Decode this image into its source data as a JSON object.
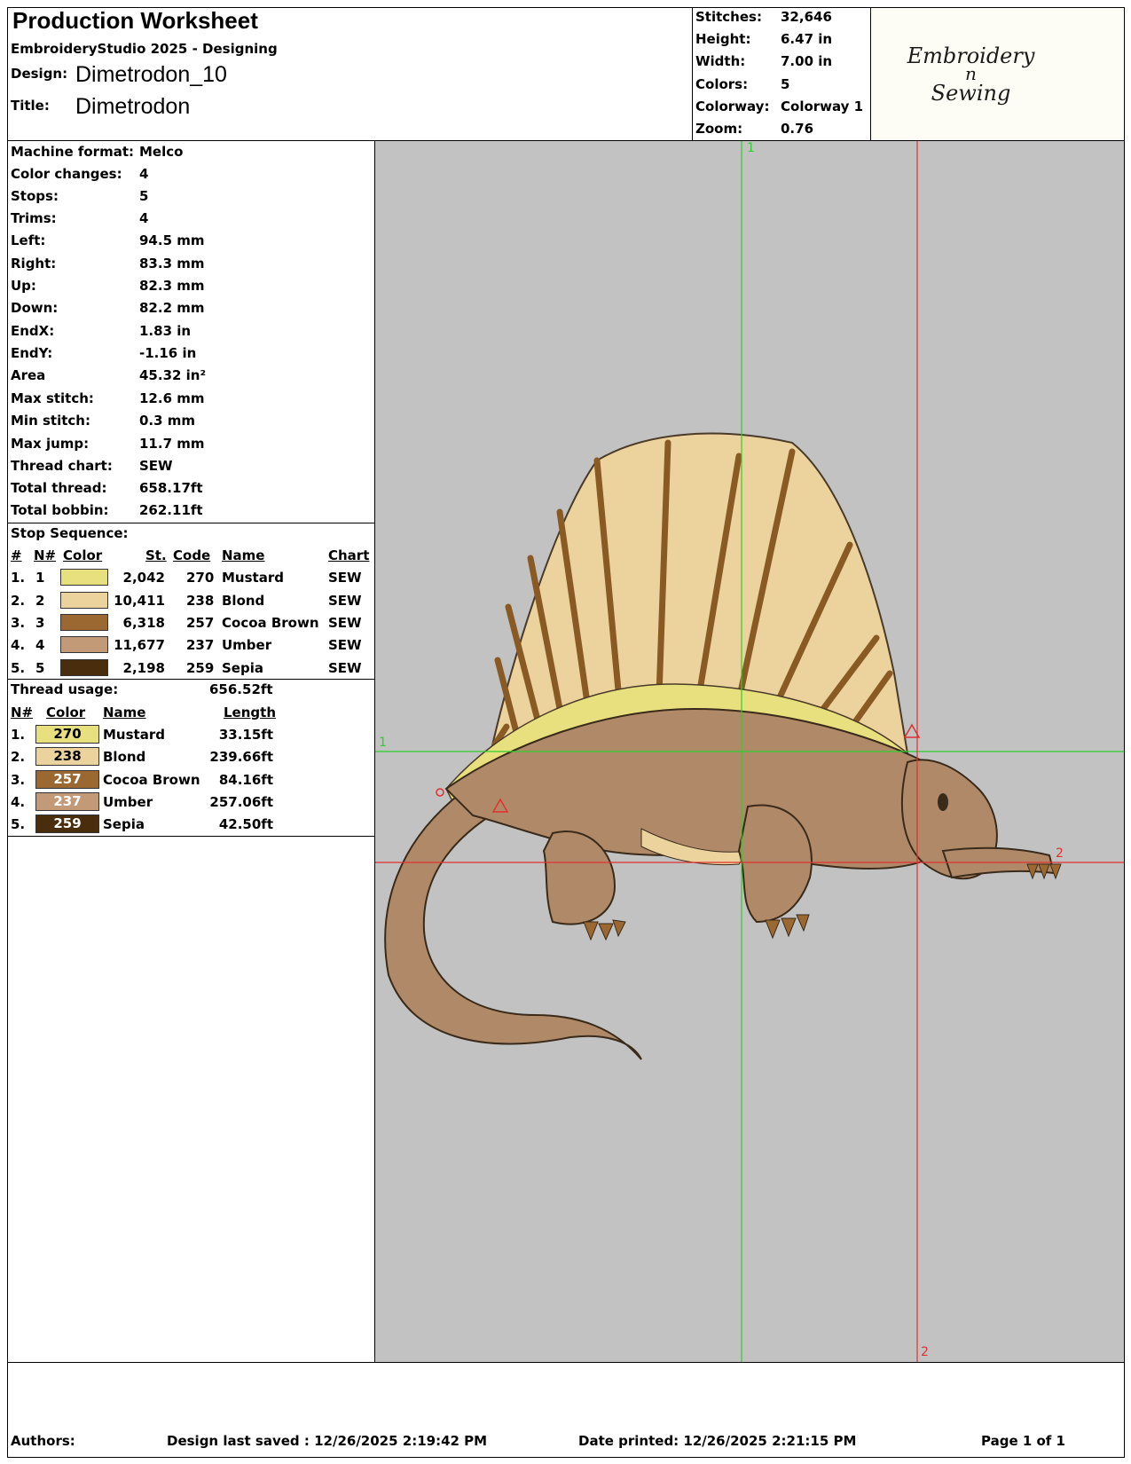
{
  "header": {
    "title": "Production Worksheet",
    "software": "EmbroideryStudio 2025 - Designing",
    "design_label": "Design:",
    "design_value": "Dimetrodon_10",
    "title_label": "Title:",
    "title_value": "Dimetrodon"
  },
  "summary": [
    {
      "label": "Stitches:",
      "value": "32,646"
    },
    {
      "label": "Height:",
      "value": "6.47 in"
    },
    {
      "label": "Width:",
      "value": "7.00 in"
    },
    {
      "label": "Colors:",
      "value": "5"
    },
    {
      "label": "Colorway:",
      "value": "Colorway 1"
    },
    {
      "label": "Zoom:",
      "value": "0.76"
    }
  ],
  "logo": {
    "line1": "Embroidery",
    "line2": "n",
    "line3": "Sewing"
  },
  "details": [
    {
      "label": "Machine format:",
      "value": "Melco"
    },
    {
      "label": "Color changes:",
      "value": "4"
    },
    {
      "label": "Stops:",
      "value": "5"
    },
    {
      "label": "Trims:",
      "value": "4"
    },
    {
      "label": "Left:",
      "value": "94.5 mm"
    },
    {
      "label": "Right:",
      "value": "83.3 mm"
    },
    {
      "label": "Up:",
      "value": "82.3 mm"
    },
    {
      "label": "Down:",
      "value": "82.2 mm"
    },
    {
      "label": "EndX:",
      "value": "1.83 in"
    },
    {
      "label": "EndY:",
      "value": "-1.16 in"
    },
    {
      "label": "Area",
      "value": " 45.32 in²"
    },
    {
      "label": "Max stitch:",
      "value": "12.6 mm"
    },
    {
      "label": "Min stitch:",
      "value": "0.3 mm"
    },
    {
      "label": "Max jump:",
      "value": "11.7 mm"
    },
    {
      "label": "Thread chart:",
      "value": "SEW"
    },
    {
      "label": "Total thread:",
      "value": "658.17ft"
    },
    {
      "label": "Total bobbin:",
      "value": "262.11ft"
    }
  ],
  "stop_sequence": {
    "title": "Stop Sequence:",
    "headers": {
      "num": "#",
      "n": "N#",
      "color": "Color",
      "st": "St.",
      "code": "Code",
      "name": "Name",
      "chart": "Chart"
    },
    "rows": [
      {
        "num": "1.",
        "n": "1",
        "color": "#e8df7e",
        "st": "2,042",
        "code": "270",
        "name": "Mustard",
        "chart": "SEW"
      },
      {
        "num": "2.",
        "n": "2",
        "color": "#ecd39e",
        "st": "10,411",
        "code": "238",
        "name": "Blond",
        "chart": "SEW"
      },
      {
        "num": "3.",
        "n": "3",
        "color": "#9a6830",
        "st": "6,318",
        "code": "257",
        "name": "Cocoa Brown",
        "chart": "SEW"
      },
      {
        "num": "4.",
        "n": "4",
        "color": "#c39a78",
        "st": "11,677",
        "code": "237",
        "name": "Umber",
        "chart": "SEW"
      },
      {
        "num": "5.",
        "n": "5",
        "color": "#4a2d0c",
        "st": "2,198",
        "code": "259",
        "name": "Sepia",
        "chart": "SEW"
      }
    ]
  },
  "thread_usage": {
    "title": "Thread usage:",
    "total": "656.52ft",
    "headers": {
      "n": "N#",
      "color": "Color",
      "name": "Name",
      "length": "Length"
    },
    "rows": [
      {
        "n": "1.",
        "code": "270",
        "color": "#e8df7e",
        "text_color": "#000000",
        "name": "Mustard",
        "length": "33.15ft"
      },
      {
        "n": "2.",
        "code": "238",
        "color": "#ecd39e",
        "text_color": "#000000",
        "name": "Blond",
        "length": "239.66ft"
      },
      {
        "n": "3.",
        "code": "257",
        "color": "#9a6830",
        "text_color": "#ffffff",
        "name": "Cocoa Brown",
        "length": "84.16ft"
      },
      {
        "n": "4.",
        "code": "237",
        "color": "#c39a78",
        "text_color": "#ffffff",
        "name": "Umber",
        "length": "257.06ft"
      },
      {
        "n": "5.",
        "code": "259",
        "color": "#4a2d0c",
        "text_color": "#ffffff",
        "name": "Sepia",
        "length": "42.50ft"
      }
    ]
  },
  "canvas": {
    "background": "#c2c2c2",
    "guide_green": "#2bd02b",
    "guide_red": "#e03030",
    "marker_v_green": "1",
    "marker_h_green": "1",
    "marker_v_red": "2",
    "marker_h_red": "2"
  },
  "footer": {
    "authors": "Authors:",
    "saved": "Design last saved : 12/26/2025 2:19:42 PM",
    "printed": "Date printed: 12/26/2025 2:21:15 PM",
    "page": "Page 1 of 1"
  }
}
